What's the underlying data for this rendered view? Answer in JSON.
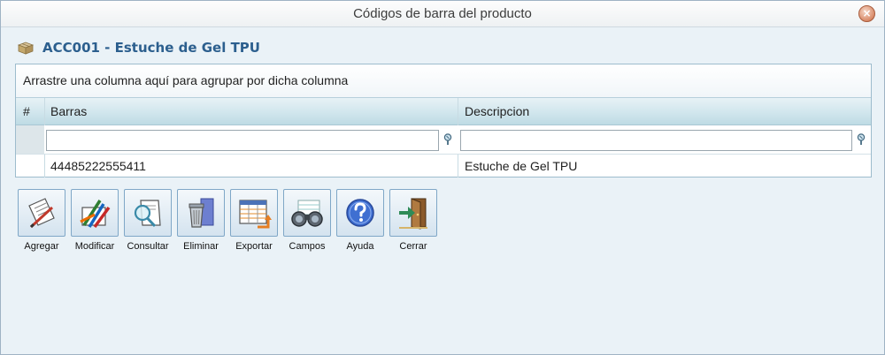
{
  "window": {
    "title": "Códigos de barra del producto",
    "close_glyph": "×"
  },
  "product": {
    "title": "ACC001 - Estuche de Gel TPU",
    "icon": "box-icon"
  },
  "grid": {
    "group_panel_text": "Arrastre una columna aquí para agrupar por dicha columna",
    "columns": {
      "index": "#",
      "barras": "Barras",
      "descripcion": "Descripcion"
    },
    "filters": {
      "barras": "",
      "descripcion": ""
    },
    "rows": [
      {
        "barras": "44485222555411",
        "descripcion": "Estuche de Gel TPU"
      }
    ]
  },
  "toolbar": {
    "buttons": [
      {
        "label": "Agregar",
        "icon": "add-document-icon"
      },
      {
        "label": "Modificar",
        "icon": "edit-pencils-icon"
      },
      {
        "label": "Consultar",
        "icon": "magnifier-document-icon"
      },
      {
        "label": "Eliminar",
        "icon": "trash-icon"
      },
      {
        "label": "Exportar",
        "icon": "export-spreadsheet-icon"
      },
      {
        "label": "Campos",
        "icon": "binoculars-icon"
      },
      {
        "label": "Ayuda",
        "icon": "help-icon"
      },
      {
        "label": "Cerrar",
        "icon": "exit-door-icon"
      }
    ]
  }
}
